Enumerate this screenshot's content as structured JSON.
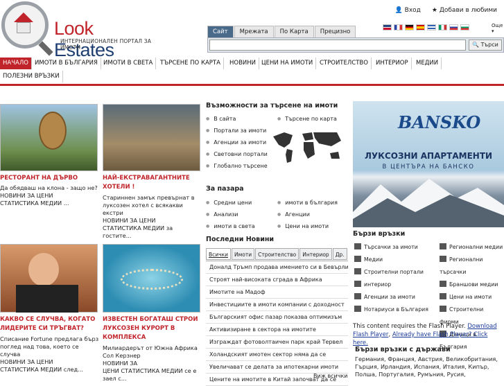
{
  "header": {
    "logo_look": "Look",
    "logo_estates": "Estates",
    "tagline": "ИНТЕРНАЦИОНАЛЕН ПОРТАЛ ЗА ИМОТИ",
    "login": "Вход",
    "favorites": "Добави в любими",
    "more": "Още"
  },
  "search": {
    "tabs": [
      "Сайт",
      "Мрежата",
      "По Карта",
      "Прецизно"
    ],
    "button": "Търси",
    "value": ""
  },
  "nav": [
    "НАЧАЛО",
    "ИМОТИ В БЪЛГАРИЯ",
    "ИМОТИ В СВЕТА",
    "ТЪРСЕНЕ ПО КАРТА",
    "НОВИНИ",
    "ЦЕНИ НА ИМОТИ",
    "СТРОИТЕЛСТВО",
    "ИНТЕРИОР",
    "МЕДИИ",
    "ПОЛЕЗНИ ВРЪЗКИ"
  ],
  "posts": [
    {
      "title": "РЕСТОРАНТ НА ДЪРВО",
      "text": "Да обядваш на клона - защо не?",
      "tags": "НОВИНИ     ЗА ЦЕНИ",
      "tags2": "СТАТИСТИКА   МЕДИИ   ..."
    },
    {
      "title": "НАЙ-ЕКСТРАВАГАНТНИТЕ ХОТЕЛИ !",
      "text": "Стариннен замък превърнат в луксозен хотел с всякакви екстри",
      "tags": "НОВИНИ     ЗА ЦЕНИ",
      "tags2": "СТАТИСТИКА   МЕДИИ за гостите..."
    },
    {
      "title": "КАКВО СЕ СЛУЧВА, КОГАТО ЛИДЕРИТЕ СИ ТРЪГВАТ?",
      "text": "Списание Fortune предлага бърз поглед над това, което се случва",
      "tags": "НОВИНИ     ЗА ЦЕНИ",
      "tags2": "СТАТИСТИКА   МЕДИИ след..."
    },
    {
      "title": "ИЗВЕСТЕН БОГАТАШ СТРОИ ЛУКСОЗЕН КУРОРТ В КОМПЛЕКСА",
      "text": "Милиардерът от Южна Африка Сол Керзнер",
      "tags": "НОВИНИ     ЗА",
      "tags2": "ЦЕНИ   СТАТИСТИКА   МЕДИИ се е заел с..."
    }
  ],
  "search_options": {
    "title": "Възможности за търсене на имоти",
    "left": [
      "В сайта",
      "Портали за имоти",
      "Агенции за имоти",
      "Световни портали",
      "Глобално търсене"
    ],
    "right": [
      "Търсене по карта"
    ]
  },
  "market": {
    "title": "За пазара",
    "left": [
      "Средни цени",
      "Анализи",
      "имоти в света"
    ],
    "right": [
      "имоти в българия",
      "Агенции",
      "Цени на имоти"
    ]
  },
  "news": {
    "title": "Последни Новини",
    "tabs": [
      "Всички",
      "Имоти",
      "Строителство",
      "Интериор",
      "Др."
    ],
    "items": [
      "Доналд Тръмп продава имението си в Бевърли",
      "Строят най-високата сграда в Африка",
      "Имотите на Мадоф",
      "Инвестициите в имоти компании с доходност",
      "Българският офис пазар показва оптимизъм",
      "Активизиране в сектора на имотите",
      "Изграждат фотоволтаичен парк край Тервел",
      "Холандският имотен сектор няма да се",
      "Увеличават се делата за ипотекарни имоти",
      "Цените на имотите в Китай започват да се"
    ],
    "more": "Виж всички"
  },
  "ad": {
    "brand": "BANSKO",
    "line1": "ЛУКСОЗНИ АПАРТАМЕНТИ",
    "line2": "В ЦЕНТЪРА НА БАНСКО"
  },
  "quick_links": {
    "title": "Бързи връзки",
    "left": [
      "Търсачки за имоти",
      "Медии",
      "Строителни портали",
      "интериор",
      "Агенции за имоти",
      "Нотариуси в България"
    ],
    "right": [
      "Регионални медии",
      "Регионални търсачки",
      "Браншови медии",
      "Цени на имоти",
      "Строителни фирми",
      "Данъци в България"
    ]
  },
  "flash": {
    "text": "This content requires the Flash Player. ",
    "link1": "Download Flash Player",
    "mid": ", ",
    "link2": "Already have Flash Player? Click here."
  },
  "countries": {
    "title": "Бързи връзки с държави",
    "line1": "Германия, Франция, Австрия, Великобритания,",
    "line2": "Гърция, Ирландия, Испания, Италия, Кипър,",
    "line3": "Полша, Португалия, Румъния, Русия,"
  }
}
